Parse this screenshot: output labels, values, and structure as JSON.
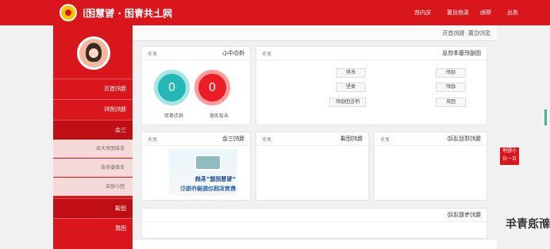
{
  "header": {
    "brand": "网上共青团 · 智慧团建",
    "menus": [
      "站内信",
      "系统设置",
      "帮助",
      "退出"
    ]
  },
  "breadcrumb": "您的位置: 我的首页",
  "sidebar": {
    "items": [
      "我的首页",
      "我的资料",
      "三会",
      "团课",
      "团费"
    ],
    "submenus": [
      "支部团员大会",
      "支部委员会",
      "团小组会"
    ]
  },
  "panels": {
    "todo": {
      "title": "待办中心",
      "more": "更多",
      "left_value": "0",
      "right_value": "0",
      "left_label": "未读消息",
      "right_label": "待办事项"
    },
    "org": {
      "title": "团组织基本信息",
      "more": "更多",
      "left_col": [
        "组织",
        "组织",
        "团员"
      ],
      "right_col": [
        "名称",
        "类型",
        "所在团组织"
      ]
    },
    "threemeet": {
      "title": "我的三会",
      "more": "更多",
      "line1": "“智慧团建”系统",
      "line2": "教育实践功能操作指引"
    },
    "activity": {
      "title": "我的团课",
      "more": "更多"
    },
    "project": {
      "title": "我的项目活动",
      "more": "更多"
    },
    "bottom": {
      "title": "我的专题活动"
    }
  },
  "floating": {
    "line1": "小程序",
    "line2": "日一日"
  },
  "watermark": "新浪青年"
}
